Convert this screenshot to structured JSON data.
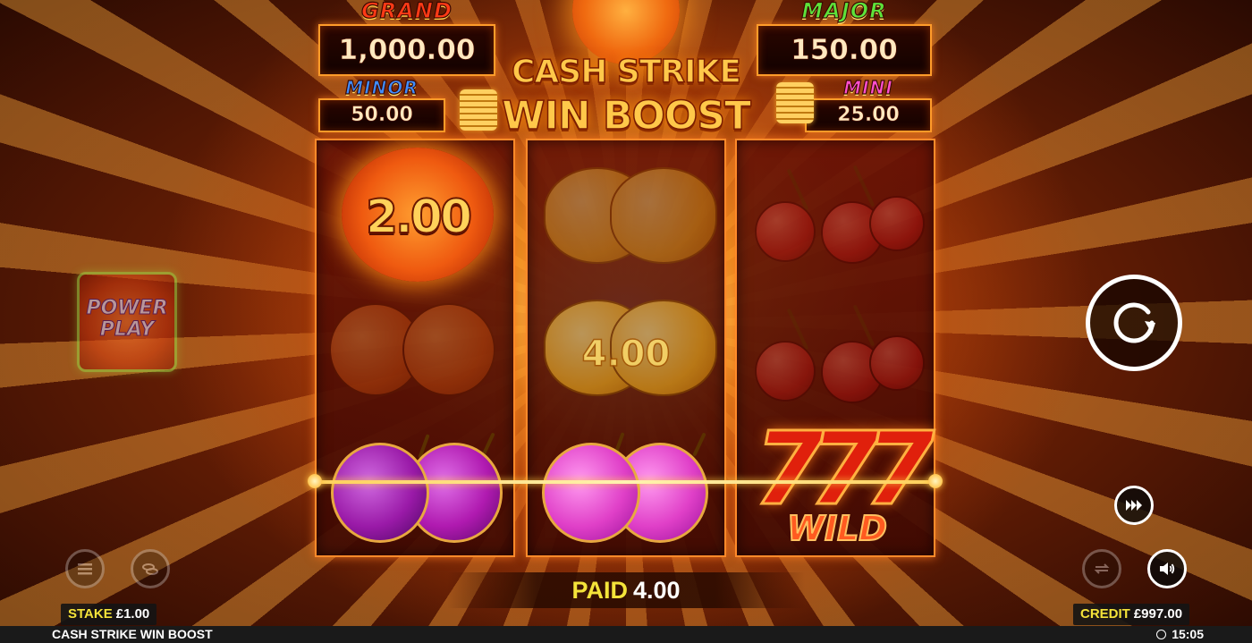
{
  "jackpots": {
    "grand": {
      "title": "GRAND",
      "value": "1,000.00"
    },
    "major": {
      "title": "MAJOR",
      "value": "150.00"
    },
    "minor": {
      "title": "MINOR",
      "value": "50.00"
    },
    "mini": {
      "title": "MINI",
      "value": "25.00"
    }
  },
  "logo": {
    "line1": "CASH STRIKE",
    "line2": "WIN BOOST"
  },
  "reels": {
    "reel1": {
      "top": {
        "symbol": "sun-coin",
        "value": "2.00"
      },
      "middle": {
        "symbol": "orange"
      },
      "bottom": {
        "symbol": "plum"
      }
    },
    "reel2": {
      "top": {
        "symbol": "lemon"
      },
      "middle": {
        "symbol": "lemon",
        "value": "4.00"
      },
      "bottom": {
        "symbol": "plum"
      }
    },
    "reel3": {
      "top": {
        "symbol": "cherry"
      },
      "middle": {
        "symbol": "cherry"
      },
      "bottom": {
        "symbol": "seven-wild",
        "label": "WILD"
      }
    }
  },
  "power_play": {
    "line1": "POWER",
    "line2": "PLAY"
  },
  "paid": {
    "label": "PAID",
    "value": "4.00"
  },
  "stake": {
    "label": "STAKE",
    "value": "£1.00"
  },
  "credit": {
    "label": "CREDIT",
    "value": "£997.00"
  },
  "footer": {
    "game_name": "CASH STRIKE WIN BOOST",
    "time": "15:05"
  },
  "icons": {
    "spin": "spin-arrow-icon",
    "menu": "menu-icon",
    "coins": "coins-icon",
    "fast": "fast-forward-icon",
    "autoplay": "autoplay-icon",
    "sound": "sound-icon",
    "clock": "clock-icon"
  },
  "colors": {
    "paid_label": "#f4e33a",
    "grand": "#ff3a16",
    "major": "#5de23a",
    "minor": "#3f8dff",
    "mini": "#ff4fd0"
  }
}
